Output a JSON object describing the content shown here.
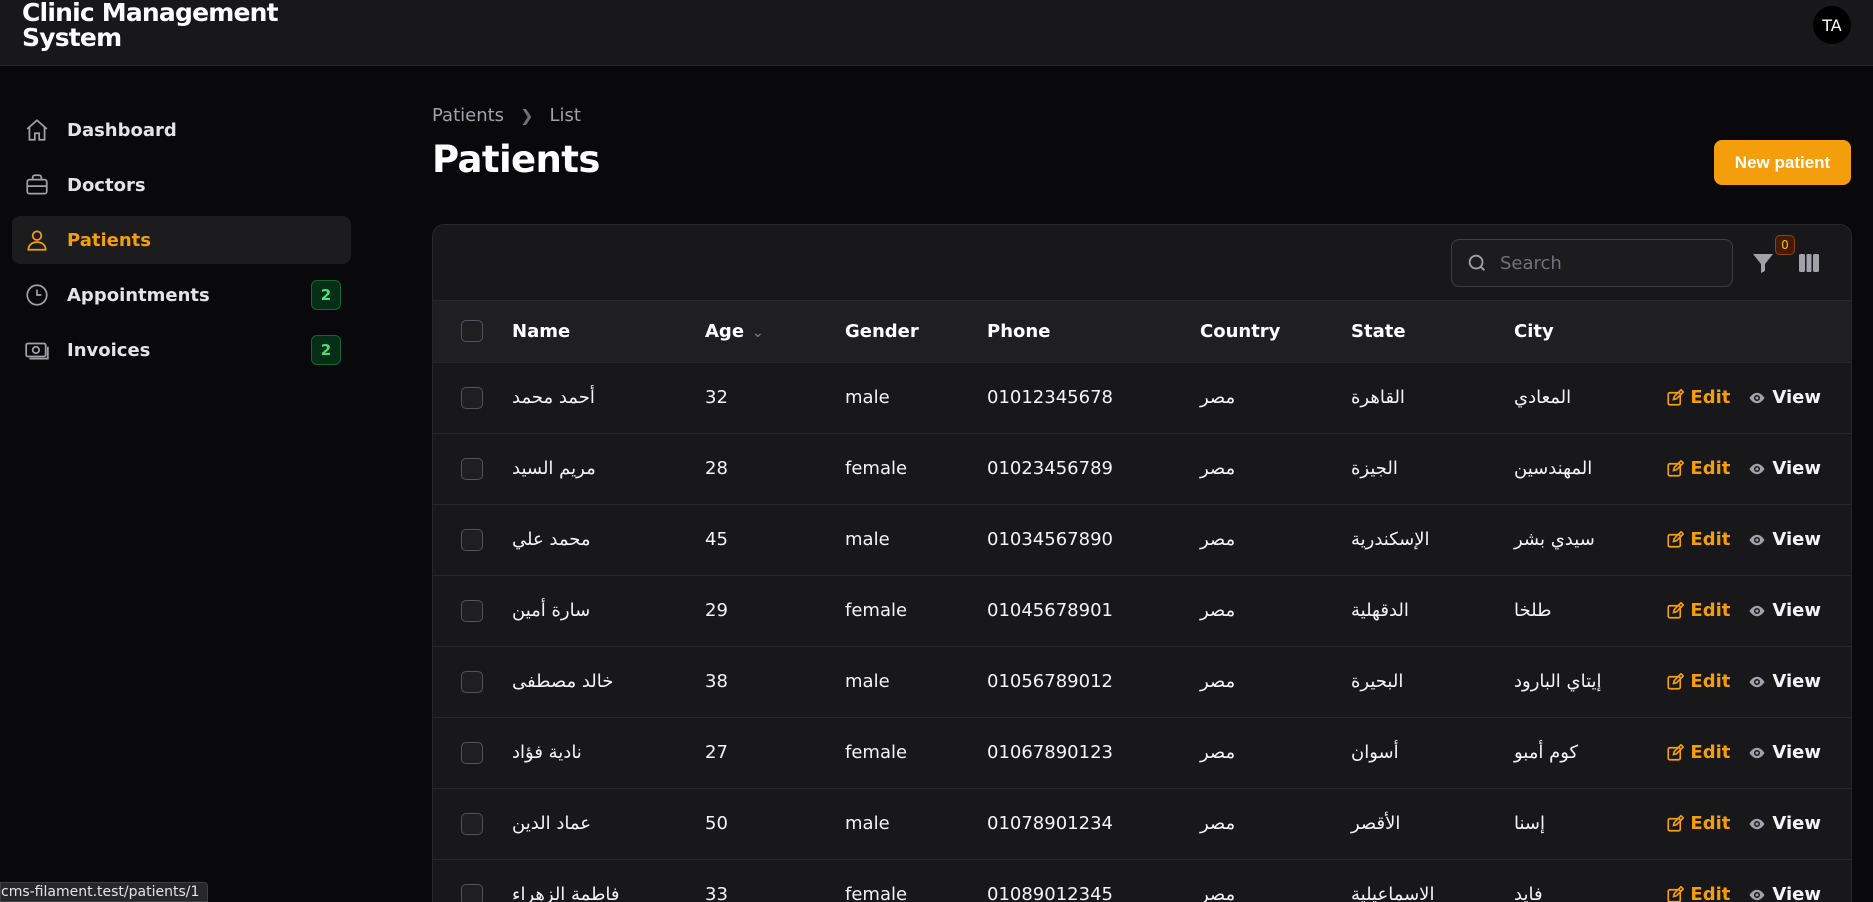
{
  "app": {
    "title": "Clinic Management System",
    "avatar_initials": "TA"
  },
  "sidebar": {
    "items": [
      {
        "label": "Dashboard",
        "icon": "home-icon",
        "active": false,
        "badge": ""
      },
      {
        "label": "Doctors",
        "icon": "briefcase-icon",
        "active": false,
        "badge": ""
      },
      {
        "label": "Patients",
        "icon": "user-icon",
        "active": true,
        "badge": ""
      },
      {
        "label": "Appointments",
        "icon": "clock-icon",
        "active": false,
        "badge": "2"
      },
      {
        "label": "Invoices",
        "icon": "banknotes-icon",
        "active": false,
        "badge": "2"
      }
    ]
  },
  "breadcrumb": {
    "items": [
      "Patients",
      "List"
    ]
  },
  "page": {
    "title": "Patients",
    "new_button": "New patient"
  },
  "toolbar": {
    "search_placeholder": "Search",
    "filter_count": "0"
  },
  "table": {
    "columns": [
      "Name",
      "Age",
      "Gender",
      "Phone",
      "Country",
      "State",
      "City"
    ],
    "sorted_column": "Age",
    "actions": {
      "edit": "Edit",
      "view": "View"
    },
    "rows": [
      [
        "أحمد محمد",
        "32",
        "male",
        "01012345678",
        "مصر",
        "القاهرة",
        "المعادي"
      ],
      [
        "مريم السيد",
        "28",
        "female",
        "01023456789",
        "مصر",
        "الجيزة",
        "المهندسين"
      ],
      [
        "محمد علي",
        "45",
        "male",
        "01034567890",
        "مصر",
        "الإسكندرية",
        "سيدي بشر"
      ],
      [
        "سارة أمين",
        "29",
        "female",
        "01045678901",
        "مصر",
        "الدقهلية",
        "طلخا"
      ],
      [
        "خالد مصطفى",
        "38",
        "male",
        "01056789012",
        "مصر",
        "البحيرة",
        "إيتاي البارود"
      ],
      [
        "نادية فؤاد",
        "27",
        "female",
        "01067890123",
        "مصر",
        "أسوان",
        "كوم أمبو"
      ],
      [
        "عماد الدين",
        "50",
        "male",
        "01078901234",
        "مصر",
        "الأقصر",
        "إسنا"
      ],
      [
        "فاطمة الزهراء",
        "33",
        "female",
        "01089012345",
        "مصر",
        "الاسماعيلية",
        "فايد"
      ]
    ]
  },
  "status_bar": {
    "url": "cms-filament.test/patients/1"
  },
  "colors": {
    "accent": "#f59e0b",
    "badge_green": "#4ade80",
    "background": "#09090b"
  }
}
